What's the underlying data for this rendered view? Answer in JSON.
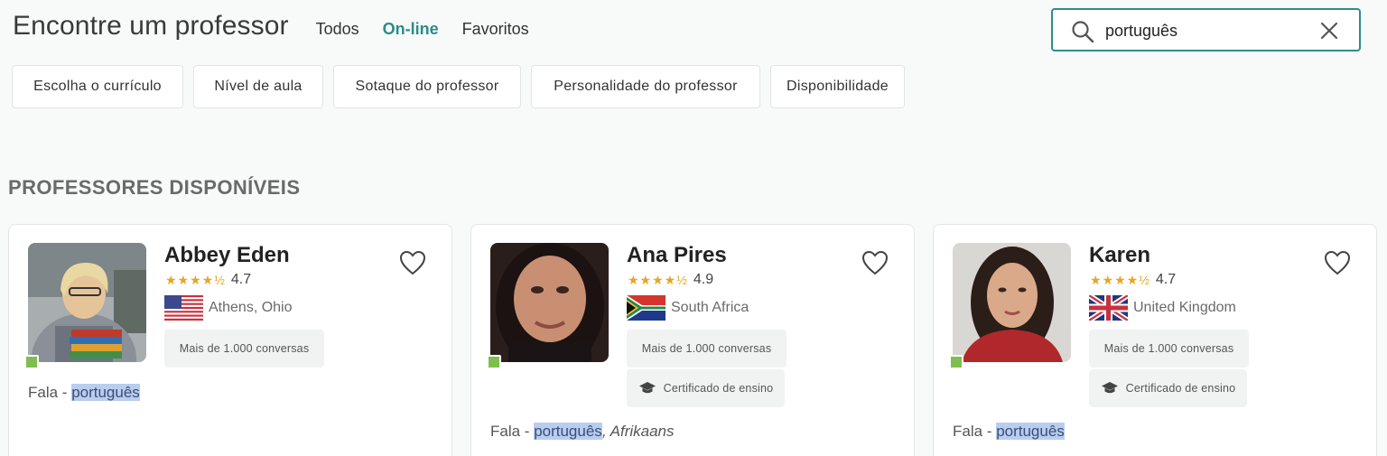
{
  "header": {
    "title": "Encontre um professor",
    "tabs": [
      {
        "label": "Todos",
        "active": false
      },
      {
        "label": "On-line",
        "active": true
      },
      {
        "label": "Favoritos",
        "active": false
      }
    ]
  },
  "search": {
    "value": "português",
    "search_icon": "search-icon",
    "clear_icon": "close-icon"
  },
  "filters": [
    "Escolha o currículo",
    "Nível de aula",
    "Sotaque do professor",
    "Personalidade do professor",
    "Disponibilidade"
  ],
  "section_title": "PROFESSORES DISPONÍVEIS",
  "colors": {
    "accent": "#2c8c86",
    "star": "#e5a525",
    "online": "#7fbf4d",
    "highlight": "#b9cdf0"
  },
  "teachers": [
    {
      "name": "Abbey Eden",
      "stars": "★★★★½",
      "rating": "4.7",
      "flag": "us-flag-icon",
      "location": "Athens, Ohio",
      "badges": [
        "Mais de 1.000 conversas"
      ],
      "speaks_prefix": "Fala - ",
      "speaks_highlight": "português",
      "speaks_other": ""
    },
    {
      "name": "Ana Pires",
      "stars": "★★★★½",
      "rating": "4.9",
      "flag": "za-flag-icon",
      "location": "South Africa",
      "badges": [
        "Mais de 1.000 conversas",
        "Certificado de ensino"
      ],
      "speaks_prefix": "Fala - ",
      "speaks_highlight": "português",
      "speaks_other": ", Afrikaans"
    },
    {
      "name": "Karen",
      "stars": "★★★★½",
      "rating": "4.7",
      "flag": "uk-flag-icon",
      "location": "United Kingdom",
      "badges": [
        "Mais de 1.000 conversas",
        "Certificado de ensino"
      ],
      "speaks_prefix": "Fala - ",
      "speaks_highlight": "português",
      "speaks_other": ""
    }
  ]
}
